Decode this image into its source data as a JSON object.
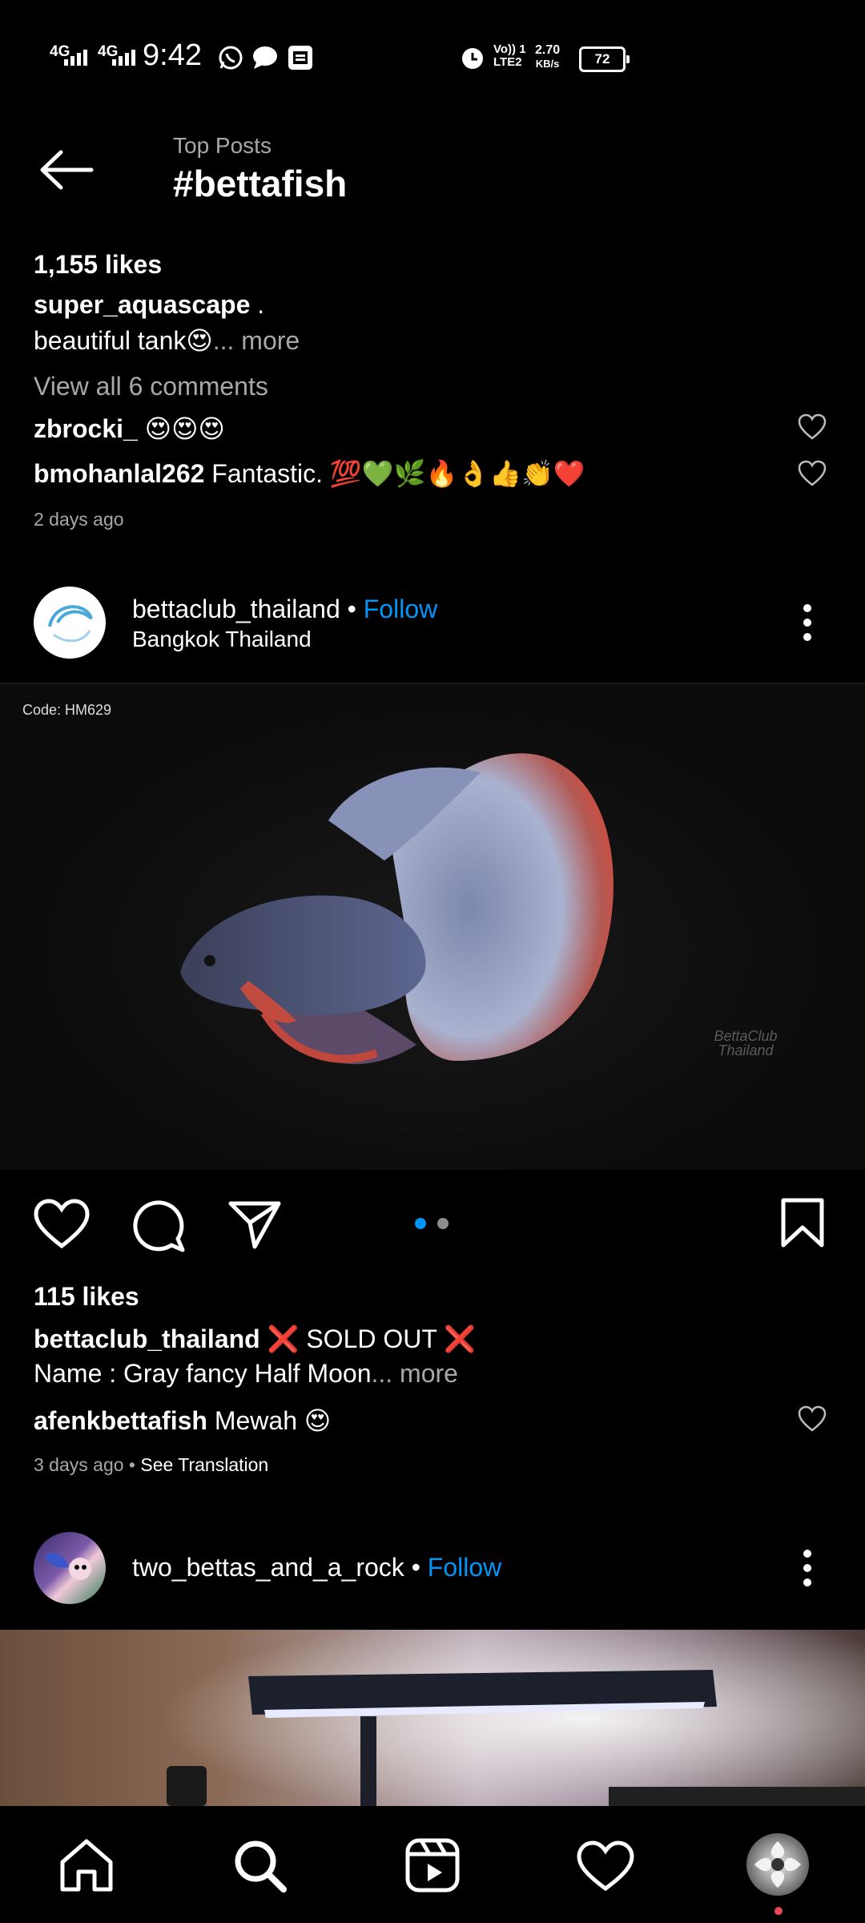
{
  "status_bar": {
    "time": "9:42",
    "net1": "4G",
    "net2": "4G",
    "volte": "Vo)) 1",
    "lte": "LTE2",
    "speed": "2.70",
    "speed_unit": "KB/s",
    "battery": "72"
  },
  "header": {
    "subtitle": "Top Posts",
    "title": "#bettafish"
  },
  "post1": {
    "likes": "1,155 likes",
    "caption_user": "super_aquascape",
    "caption_rest": " .",
    "caption_line2": "beautiful tank😍",
    "more": "... more",
    "view_comments": "View all 6 comments",
    "comments": [
      {
        "user": "zbrocki_",
        "text": " 😍😍😍"
      },
      {
        "user": "bmohanlal262",
        "text": " Fantastic. 💯💚🌿🔥👌👍👏❤️"
      }
    ],
    "time": "2 days ago"
  },
  "post2": {
    "user": "bettaclub_thailand",
    "sep": " • ",
    "follow": "Follow",
    "location": "Bangkok Thailand",
    "avatar_text": "BettaClub Thailand",
    "code": "Code: HM629",
    "watermark": "BettaClub Thailand",
    "likes": "115 likes",
    "caption_user": "bettaclub_thailand",
    "caption_text": " ❌ SOLD OUT ❌",
    "caption_line2": "Name : Gray fancy Half Moon",
    "more": "... more",
    "comment_user": "afenkbettafish",
    "comment_text": " Mewah 😍",
    "time": "3 days ago",
    "see_translation": "See Translation",
    "carousel_active": 1,
    "carousel_total": 2
  },
  "post3": {
    "user": "two_bettas_and_a_rock",
    "sep": " • ",
    "follow": "Follow"
  },
  "nav": {
    "items": [
      "home-icon",
      "search-icon",
      "reels-icon",
      "heart-icon",
      "profile-avatar"
    ],
    "active": "search-icon"
  },
  "colors": {
    "accent": "#0095f6",
    "background": "#000000",
    "secondary_text": "#a8a8a8",
    "notification_dot": "#ed4956"
  }
}
